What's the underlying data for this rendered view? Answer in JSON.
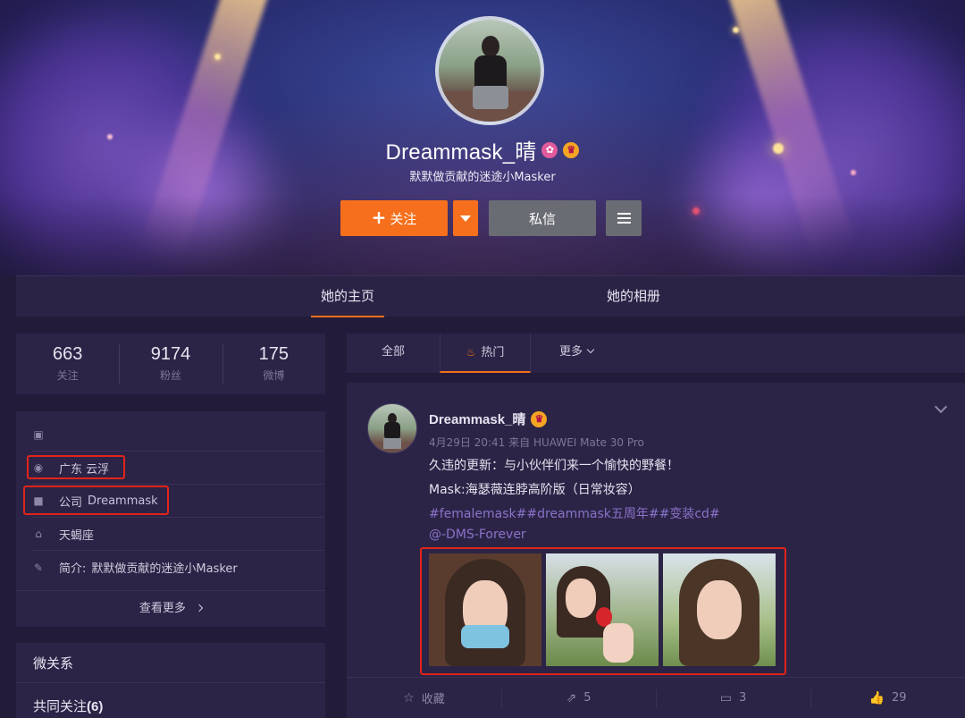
{
  "profile": {
    "name": "Dreammask_晴",
    "bio": "默默做贡献的迷途小Masker",
    "follow_label": "关注",
    "message_label": "私信"
  },
  "tabs": {
    "home": "她的主页",
    "album": "她的相册"
  },
  "stats": [
    {
      "value": "663",
      "label": "关注"
    },
    {
      "value": "9174",
      "label": "粉丝"
    },
    {
      "value": "175",
      "label": "微博"
    }
  ],
  "info": {
    "location": "广东 云浮",
    "company_key": "公司",
    "company_value": "Dreammask",
    "birthday": "天蝎座",
    "intro_key": "简介:",
    "intro_value": "默默做贡献的迷途小Masker",
    "more": "查看更多"
  },
  "relations": {
    "title": "微关系",
    "common_label": "共同关注",
    "common_count": "(6)"
  },
  "feed_filter": {
    "all": "全部",
    "hot": "热门",
    "more": "更多"
  },
  "post": {
    "user": "Dreammask_晴",
    "time": "4月29日 20:41",
    "from_label": "来自",
    "source": "HUAWEI Mate 30 Pro",
    "line1": "久违的更新：与小伙伴们来一个愉快的野餐！",
    "line2": "Mask:海瑟薇连脖高阶版（日常妆容）",
    "tags": "#femalemask##dreammask五周年##变装cd#",
    "mention": "@-DMS-Forever",
    "actions": {
      "favorite": "收藏",
      "repost": "5",
      "comment": "3",
      "like": "29"
    }
  },
  "colors": {
    "accent": "#f56f1c",
    "highlight_box": "#e2231a",
    "link": "#8a72c9",
    "panel": "#2c2446",
    "background": "#231b3a"
  }
}
